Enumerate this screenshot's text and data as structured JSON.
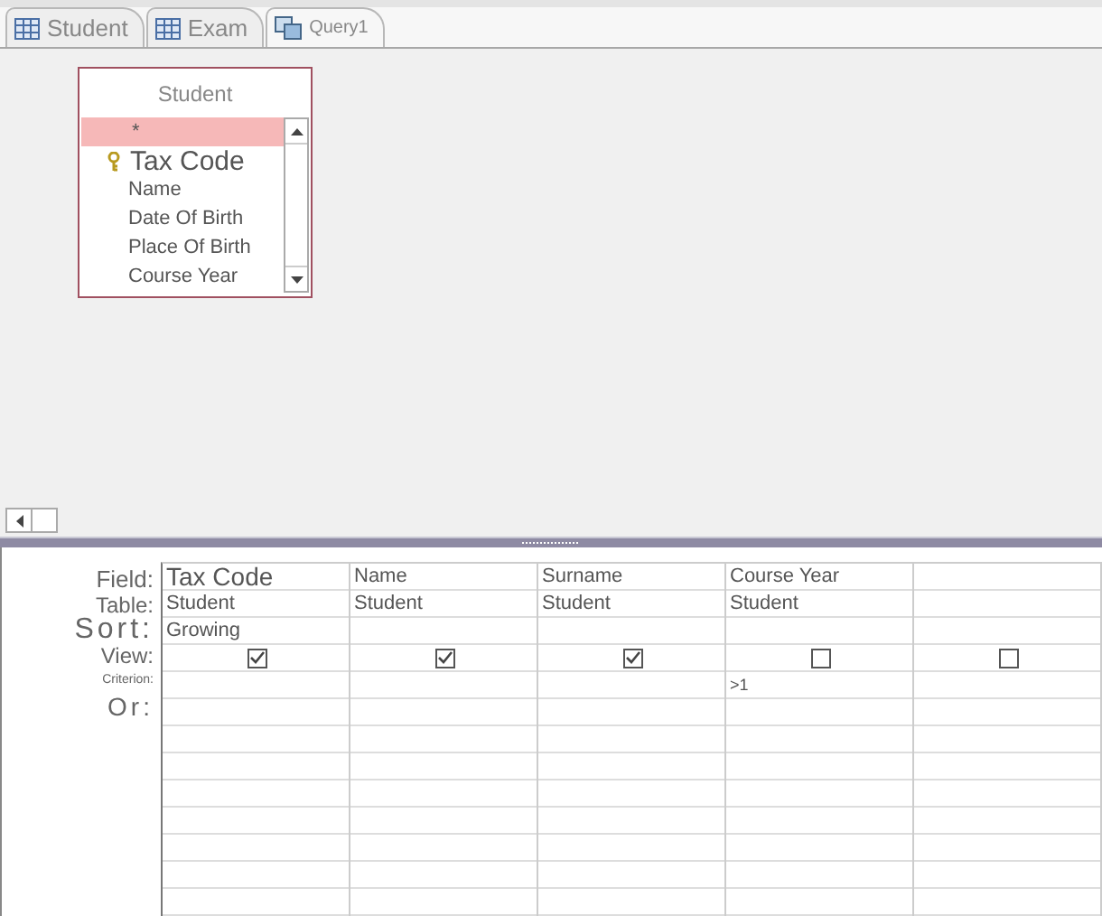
{
  "tabs": [
    {
      "label": "Student",
      "kind": "table",
      "selected": false
    },
    {
      "label": "Exam",
      "kind": "table",
      "selected": false
    },
    {
      "label": "Query1",
      "kind": "query",
      "selected": true
    }
  ],
  "table_box": {
    "title": "Student",
    "fields": [
      {
        "name": "*",
        "primary_key": false,
        "selected": true
      },
      {
        "name": "Tax Code",
        "primary_key": true,
        "selected": false
      },
      {
        "name": "Name",
        "primary_key": false,
        "selected": false
      },
      {
        "name": "Date Of Birth",
        "primary_key": false,
        "selected": false
      },
      {
        "name": "Place Of Birth",
        "primary_key": false,
        "selected": false
      },
      {
        "name": "Course Year",
        "primary_key": false,
        "selected": false
      }
    ]
  },
  "grid": {
    "row_labels": [
      "Field:",
      "Table:",
      "Sort:",
      "View:",
      "Criterion:",
      "Or:"
    ],
    "columns": [
      {
        "field": "Tax Code",
        "table": "Student",
        "sort": "Growing",
        "view": true
      },
      {
        "field": "Name",
        "table": "Student",
        "view": true
      },
      {
        "field": "Surname",
        "table": "Student",
        "view": true
      },
      {
        "field": "Course Year",
        "table": "Student",
        "view": false,
        "criterion": ">1"
      },
      {
        "view": false
      }
    ]
  }
}
